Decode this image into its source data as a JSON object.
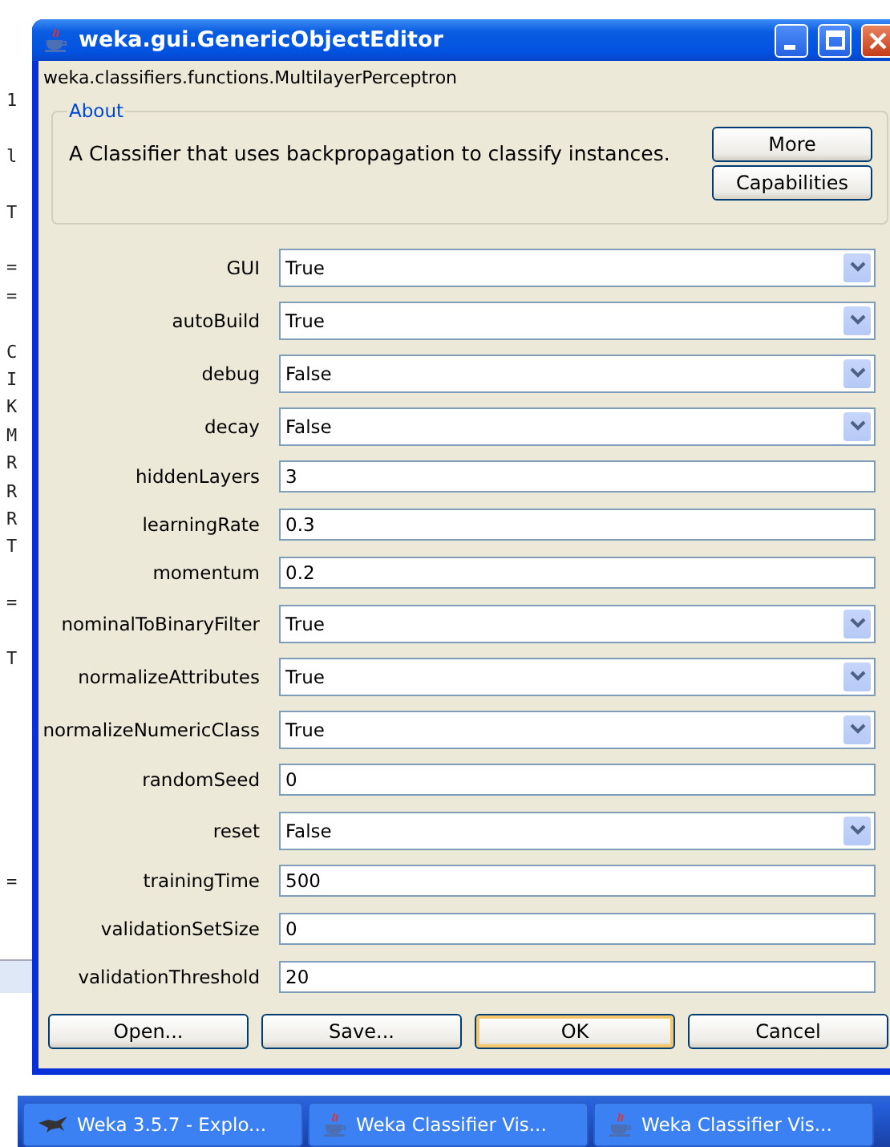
{
  "background_window": {
    "line_groups": [
      [
        "1"
      ],
      [
        "l"
      ],
      [
        "T"
      ],
      [
        "=",
        "="
      ],
      [
        "C",
        "I",
        "K",
        "M",
        "R",
        "R",
        "R",
        "T"
      ],
      [
        "="
      ],
      [
        "T"
      ],
      [
        "="
      ]
    ]
  },
  "window": {
    "title": "weka.gui.GenericObjectEditor"
  },
  "class_name": "weka.classifiers.functions.MultilayerPerceptron",
  "about": {
    "legend": "About",
    "text": "A Classifier that uses backpropagation to classify instances.",
    "buttons": [
      "More",
      "Capabilities"
    ]
  },
  "properties": [
    {
      "label": "GUI",
      "kind": "choice",
      "value": "True"
    },
    {
      "label": "autoBuild",
      "kind": "choice",
      "value": "True"
    },
    {
      "label": "debug",
      "kind": "choice",
      "value": "False"
    },
    {
      "label": "decay",
      "kind": "choice",
      "value": "False"
    },
    {
      "label": "hiddenLayers",
      "kind": "text",
      "value": "3"
    },
    {
      "label": "learningRate",
      "kind": "text",
      "value": "0.3"
    },
    {
      "label": "momentum",
      "kind": "text",
      "value": "0.2"
    },
    {
      "label": "nominalToBinaryFilter",
      "kind": "choice",
      "value": "True"
    },
    {
      "label": "normalizeAttributes",
      "kind": "choice",
      "value": "True"
    },
    {
      "label": "normalizeNumericClass",
      "kind": "choice",
      "value": "True"
    },
    {
      "label": "randomSeed",
      "kind": "text",
      "value": "0"
    },
    {
      "label": "reset",
      "kind": "choice",
      "value": "False"
    },
    {
      "label": "trainingTime",
      "kind": "text",
      "value": "500"
    },
    {
      "label": "validationSetSize",
      "kind": "text",
      "value": "0"
    },
    {
      "label": "validationThreshold",
      "kind": "text",
      "value": "20"
    }
  ],
  "buttons": [
    {
      "label": "Open...",
      "focused": false
    },
    {
      "label": "Save...",
      "focused": false
    },
    {
      "label": "OK",
      "focused": true
    },
    {
      "label": "Cancel",
      "focused": false
    }
  ],
  "taskbar": [
    {
      "label": "Weka 3.5.7 - Explo...",
      "kind": "bird"
    },
    {
      "label": "Weka Classifier Vis...",
      "kind": "cup"
    },
    {
      "label": "Weka Classifier Vis...",
      "kind": "cup"
    }
  ]
}
